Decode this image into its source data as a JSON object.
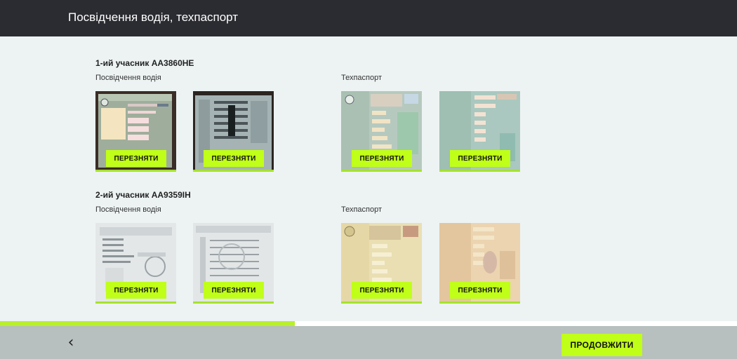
{
  "header": {
    "title": "Посвідчення водія, техпаспорт"
  },
  "participants": [
    {
      "title": "1-ий учасник АА3860НЕ",
      "license_label": "Посвідчення водія",
      "registration_label": "Техпаспорт",
      "retake_labels": [
        "ПЕРЕЗНЯТИ",
        "ПЕРЕЗНЯТИ",
        "ПЕРЕЗНЯТИ",
        "ПЕРЕЗНЯТИ"
      ]
    },
    {
      "title": "2-ий учасник АА9359ІН",
      "license_label": "Посвідчення водія",
      "registration_label": "Техпаспорт",
      "retake_labels": [
        "ПЕРЕЗНЯТИ",
        "ПЕРЕЗНЯТИ",
        "ПЕРЕЗНЯТИ",
        "ПЕРЕЗНЯТИ"
      ]
    }
  ],
  "document_images": {
    "p1_license_front": "driver-license-front-photo",
    "p1_license_back": "driver-license-back-photo",
    "p1_registration_front": "vehicle-registration-front-photo",
    "p1_registration_back": "vehicle-registration-back-photo",
    "p2_license_front": "driver-license-front-photo",
    "p2_license_back": "driver-license-back-photo",
    "p2_registration_front": "vehicle-registration-front-photo",
    "p2_registration_back": "vehicle-registration-back-photo"
  },
  "progress": {
    "fraction": 0.4
  },
  "footer": {
    "back_icon": "chevron-left-icon",
    "back_glyph": "‹",
    "continue_label": "ПРОДОВЖИТИ"
  },
  "colors": {
    "accent": "#c0ff18",
    "header_bg": "#2b2c31",
    "footer_bg": "#b7bfbf",
    "page_bg": "#edf3f3"
  }
}
